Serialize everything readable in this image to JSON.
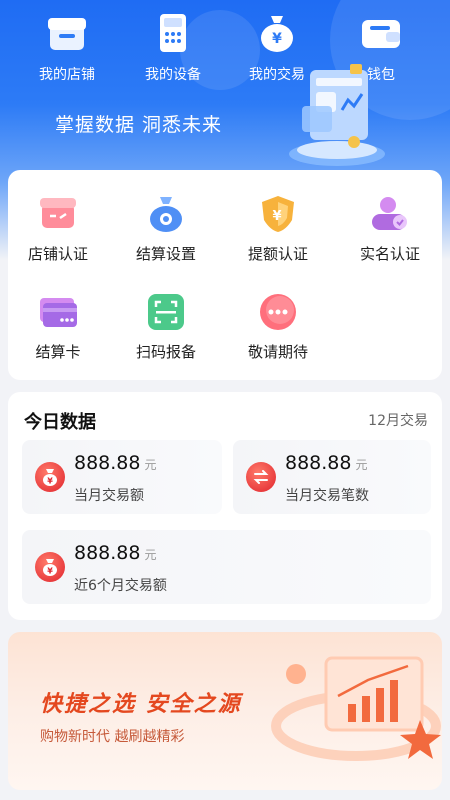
{
  "nav": [
    {
      "label": "我的店铺",
      "icon": "store-icon"
    },
    {
      "label": "我的设备",
      "icon": "pos-device-icon"
    },
    {
      "label": "我的交易",
      "icon": "money-bag-icon"
    },
    {
      "label": "钱包",
      "icon": "wallet-icon"
    }
  ],
  "slogan": "掌握数据 洞悉未来",
  "services": [
    {
      "label": "店铺认证",
      "icon": "store-verify-icon"
    },
    {
      "label": "结算设置",
      "icon": "settlement-settings-icon"
    },
    {
      "label": "提额认证",
      "icon": "limit-increase-shield-icon"
    },
    {
      "label": "实名认证",
      "icon": "real-name-verify-icon"
    },
    {
      "label": "结算卡",
      "icon": "bank-card-icon"
    },
    {
      "label": "扫码报备",
      "icon": "scan-code-icon"
    },
    {
      "label": "敬请期待",
      "icon": "more-icon"
    }
  ],
  "today": {
    "title": "今日数据",
    "link": "12月交易",
    "unit": "元",
    "stats": [
      {
        "value": "888.88",
        "label": "当月交易额",
        "icon": "money-bag-icon"
      },
      {
        "value": "888.88",
        "label": "当月交易笔数",
        "icon": "exchange-icon"
      },
      {
        "value": "888.88",
        "label": "近6个月交易额",
        "icon": "money-bag-icon"
      }
    ]
  },
  "banner": {
    "title": "快捷之选  安全之源",
    "subtitle": "购物新时代 越刷越精彩"
  },
  "colors": {
    "primary": "#1f6cf3",
    "accent_red": "#e0242c",
    "banner_text": "#e4481f"
  }
}
